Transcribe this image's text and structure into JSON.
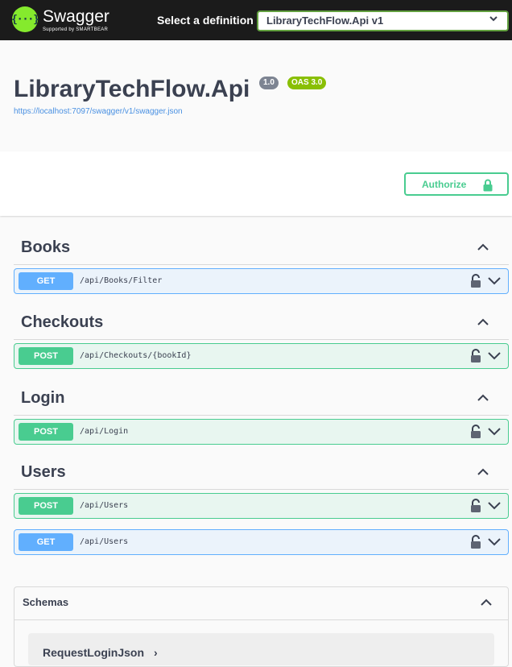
{
  "topbar": {
    "logo_name": "Swagger",
    "logo_sub": "Supported by SMARTBEAR",
    "logo_glyph": "{···}",
    "definition_label": "Select a definition",
    "definition_selected": "LibraryTechFlow.Api v1"
  },
  "info": {
    "title": "LibraryTechFlow.Api",
    "version": "1.0",
    "oas": "OAS 3.0",
    "spec_url": "https://localhost:7097/swagger/v1/swagger.json"
  },
  "authorize": {
    "label": "Authorize"
  },
  "tags": [
    {
      "name": "Books",
      "operations": [
        {
          "method": "GET",
          "path": "/api/Books/Filter"
        }
      ]
    },
    {
      "name": "Checkouts",
      "operations": [
        {
          "method": "POST",
          "path": "/api/Checkouts/{bookId}"
        }
      ]
    },
    {
      "name": "Login",
      "operations": [
        {
          "method": "POST",
          "path": "/api/Login"
        }
      ]
    },
    {
      "name": "Users",
      "operations": [
        {
          "method": "POST",
          "path": "/api/Users"
        },
        {
          "method": "GET",
          "path": "/api/Users"
        }
      ]
    }
  ],
  "schemas": {
    "title": "Schemas",
    "models": [
      {
        "name": "RequestLoginJson",
        "arrow": "›"
      }
    ]
  },
  "colors": {
    "get": "#61affe",
    "post": "#49cc90",
    "topbar": "#1b1b1b",
    "brand": "#85ea2d"
  },
  "icons": [
    "swagger-logo-icon",
    "chevron-down-icon",
    "lock-icon",
    "chevron-up-icon"
  ]
}
